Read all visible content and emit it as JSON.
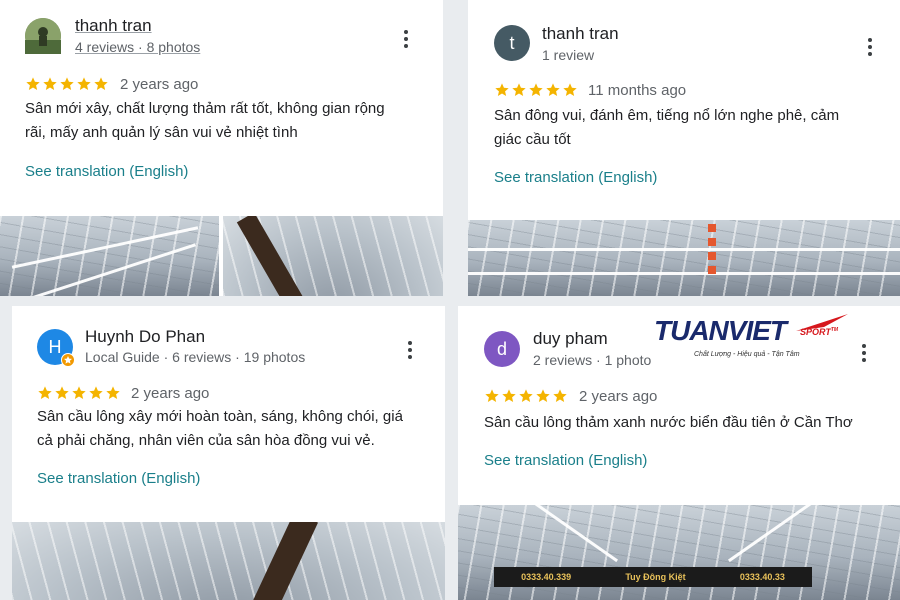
{
  "colors": {
    "star": "#f4b400",
    "link": "#1a7f8a",
    "avatar_t": "#455a64",
    "avatar_h": "#1e88e5",
    "avatar_d": "#7e57c2",
    "logo_blue": "#1a2a6c",
    "logo_red": "#d6171c"
  },
  "reviews": [
    {
      "author": "thanh tran",
      "meta": "4 reviews · 8 photos",
      "rating": 5,
      "date": "2 years ago",
      "text_lines": [
        "Sân mới xây, chất lượng thảm rất tốt, không gian rộng",
        "rãi, mấy anh quản lý sân vui vẻ nhiệt tình"
      ],
      "translate": "See translation (English)",
      "avatar_icon": "photo-avatar"
    },
    {
      "author": "thanh tran",
      "meta": "1 review",
      "rating": 5,
      "date": "11 months ago",
      "avatar_letter": "t",
      "text_lines": [
        "Sân đông vui, đánh êm, tiếng nổ lớn nghe phê, cảm",
        "giác cầu tốt"
      ],
      "translate": "See translation (English)"
    },
    {
      "author": "Huynh Do Phan",
      "meta": "Local Guide · 6 reviews · 19 photos",
      "rating": 5,
      "date": "2 years ago",
      "avatar_letter": "H",
      "text_lines": [
        "Sân cầu lông xây mới hoàn toàn, sáng, không chói, giá",
        "cả phải chăng, nhân viên của sân hòa đồng vui vẻ."
      ],
      "translate": "See translation (English)"
    },
    {
      "author": "duy pham",
      "meta": "2 reviews · 1 photo",
      "rating": 5,
      "date": "2 years ago",
      "avatar_letter": "d",
      "text_lines": [
        "Sân cầu lông thảm xanh nước biển đầu tiên ở Cần Thơ"
      ],
      "translate": "See translation (English)"
    }
  ],
  "logo": {
    "brand": "TUANVIET",
    "brand_suffix": "SPORT",
    "tm": "TM",
    "tagline": "Chất Lượng - Hiệu quả - Tận Tâm"
  },
  "photo_banner": {
    "text_1": "0333.40.339",
    "text_2": "Tuy Đông Kiệt",
    "text_3": "0333.40.33"
  },
  "icons": {
    "menu": "kebab-menu-icon",
    "star": "star-icon",
    "local_guide_badge": "local-guide-badge-icon"
  }
}
